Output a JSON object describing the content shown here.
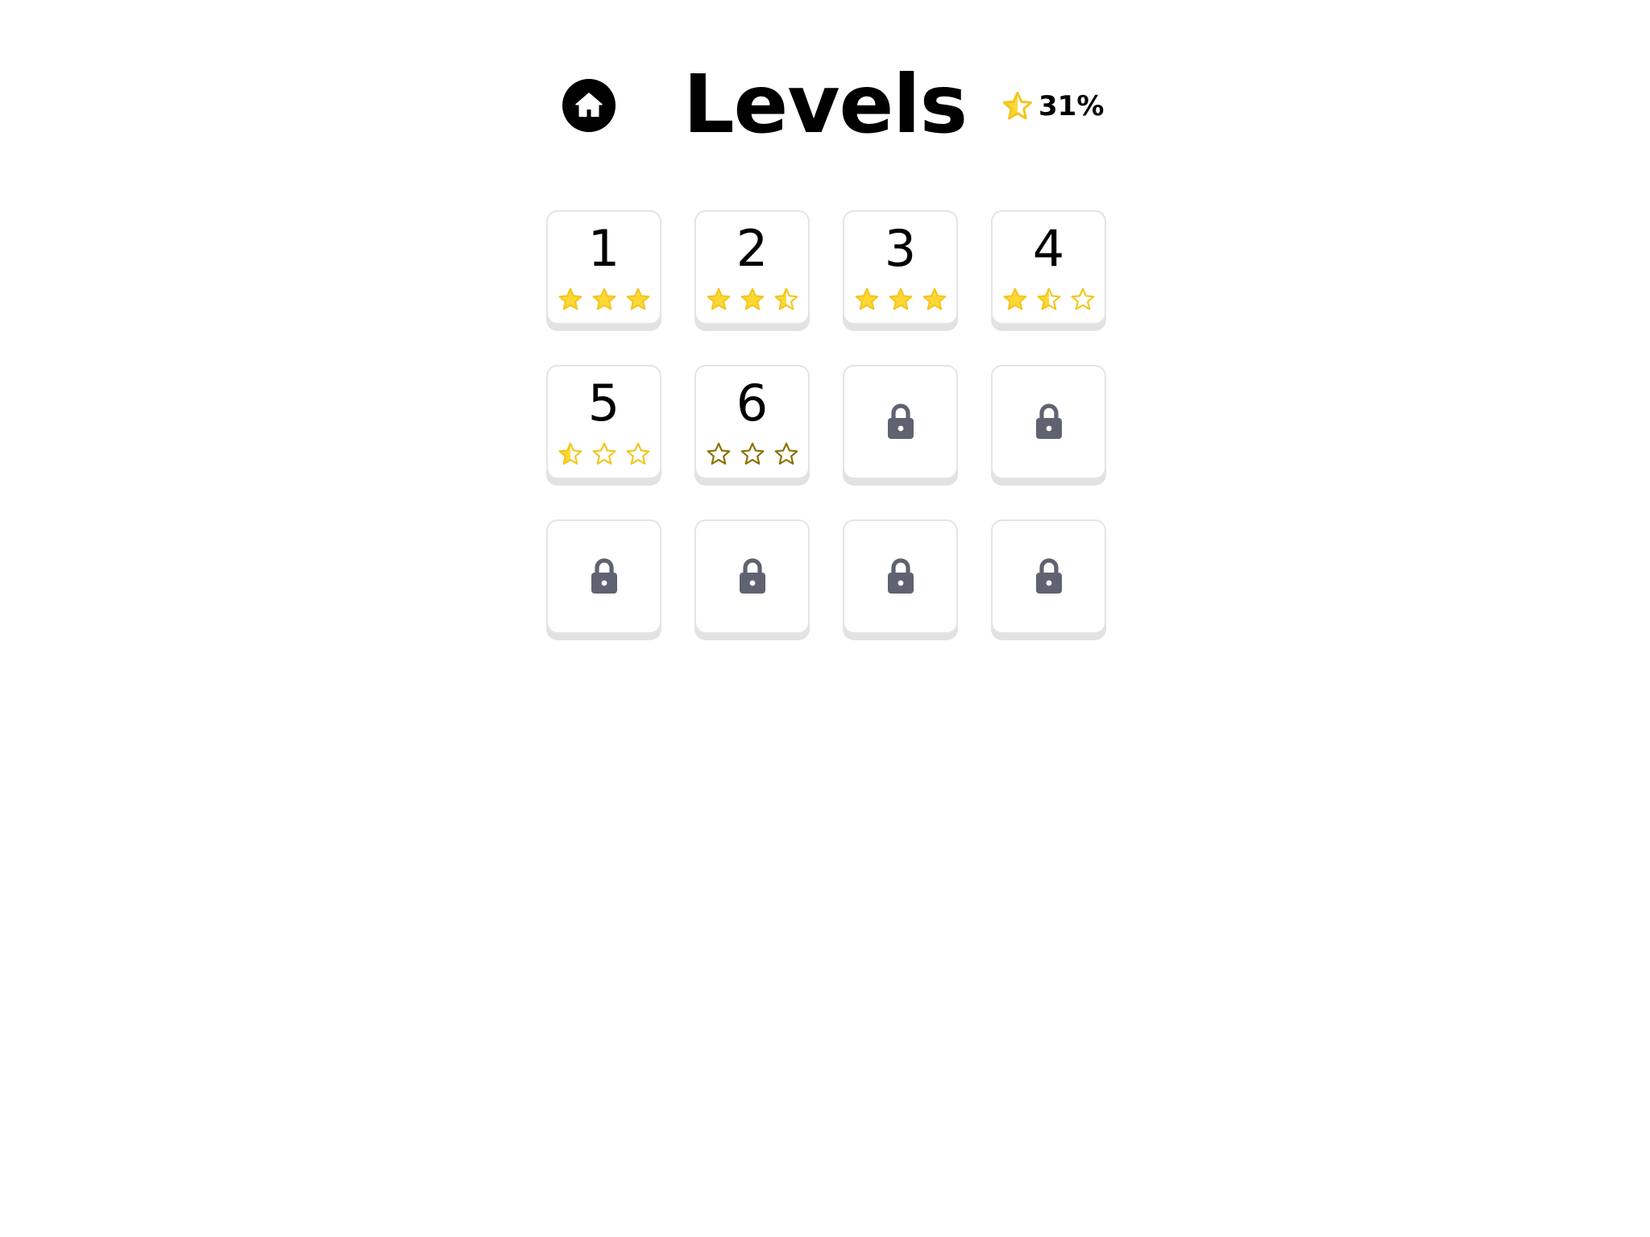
{
  "header": {
    "title": "Levels",
    "progress_text": "31%",
    "home_icon": "home-icon",
    "progress_icon": "half-star-icon"
  },
  "colors": {
    "star_gold": "#FDD835",
    "star_stroke": "#F3C61F",
    "star_empty_dark": "#8a7000",
    "lock_gray": "#5f6270",
    "tile_border": "#e4e4e4"
  },
  "levels": [
    {
      "number": "1",
      "locked": false,
      "stars": [
        "full",
        "full",
        "full"
      ]
    },
    {
      "number": "2",
      "locked": false,
      "stars": [
        "full",
        "full",
        "half"
      ]
    },
    {
      "number": "3",
      "locked": false,
      "stars": [
        "full",
        "full",
        "full"
      ]
    },
    {
      "number": "4",
      "locked": false,
      "stars": [
        "full",
        "half",
        "empty"
      ]
    },
    {
      "number": "5",
      "locked": false,
      "stars": [
        "half",
        "empty",
        "empty"
      ]
    },
    {
      "number": "6",
      "locked": false,
      "stars": [
        "empty-dark",
        "empty-dark",
        "empty-dark"
      ]
    },
    {
      "number": "",
      "locked": true,
      "stars": []
    },
    {
      "number": "",
      "locked": true,
      "stars": []
    },
    {
      "number": "",
      "locked": true,
      "stars": []
    },
    {
      "number": "",
      "locked": true,
      "stars": []
    },
    {
      "number": "",
      "locked": true,
      "stars": []
    },
    {
      "number": "",
      "locked": true,
      "stars": []
    }
  ]
}
